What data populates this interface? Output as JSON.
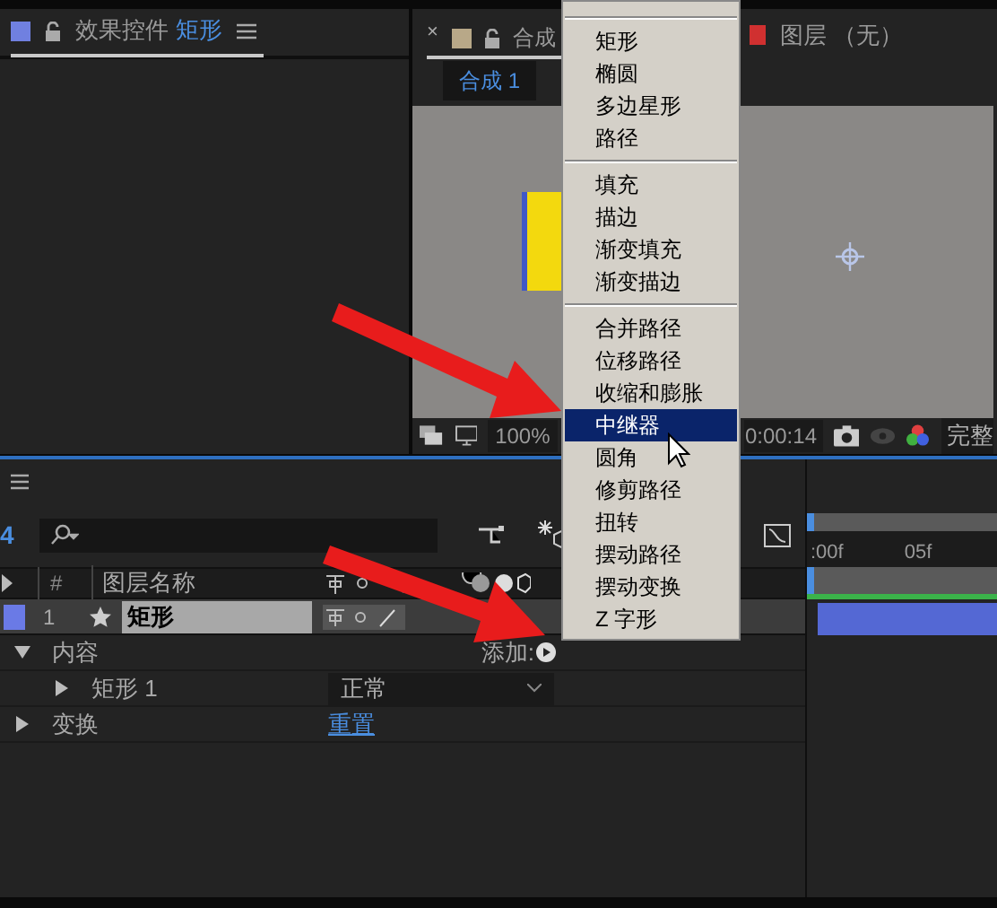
{
  "effect_controls": {
    "tab_label": "效果控件",
    "layer_name": "矩形"
  },
  "composition_panel": {
    "close_glyph": "×",
    "tab_label": "合成",
    "layer_tab": "图层 （无）",
    "comp_tab": "合成 1",
    "zoom": "100%",
    "timecode": "0:00:14",
    "resolution": "完整"
  },
  "context_menu": {
    "sections": [
      {
        "items": [
          {
            "label": "矩形",
            "selected": false
          },
          {
            "label": "椭圆",
            "selected": false
          },
          {
            "label": "多边星形",
            "selected": false
          },
          {
            "label": "路径",
            "selected": false
          }
        ]
      },
      {
        "items": [
          {
            "label": "填充",
            "selected": false
          },
          {
            "label": "描边",
            "selected": false
          },
          {
            "label": "渐变填充",
            "selected": false
          },
          {
            "label": "渐变描边",
            "selected": false
          }
        ]
      },
      {
        "items": [
          {
            "label": "合并路径",
            "selected": false
          },
          {
            "label": "位移路径",
            "selected": false
          },
          {
            "label": "收缩和膨胀",
            "selected": false
          },
          {
            "label": "中继器",
            "selected": true
          },
          {
            "label": "圆角",
            "selected": false
          },
          {
            "label": "修剪路径",
            "selected": false
          },
          {
            "label": "扭转",
            "selected": false
          },
          {
            "label": "摆动路径",
            "selected": false
          },
          {
            "label": "摆动变换",
            "selected": false
          },
          {
            "label": "Z 字形",
            "selected": false
          }
        ]
      }
    ]
  },
  "timeline": {
    "current_time": "4",
    "ruler": [
      ":00f",
      "05f"
    ],
    "columns": [
      "#",
      "图层名称"
    ],
    "layers": [
      {
        "number": "1",
        "name": "矩形",
        "selected": true
      }
    ],
    "properties": [
      {
        "label": "内容",
        "expanded": true,
        "add_label": "添加:",
        "children": [
          {
            "label": "矩形 1",
            "expanded": false,
            "blend_mode": "正常"
          }
        ]
      },
      {
        "label": "变换",
        "expanded": false,
        "reset_link": "重置"
      }
    ]
  }
}
